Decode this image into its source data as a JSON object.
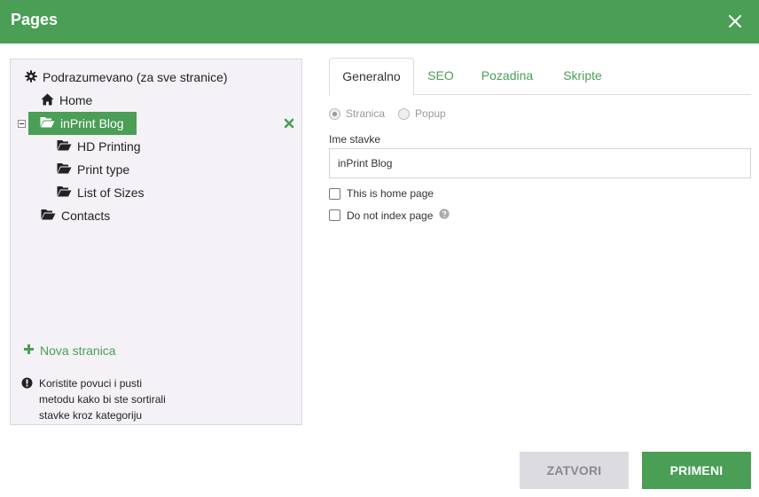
{
  "header": {
    "title": "Pages"
  },
  "tree": {
    "items": [
      {
        "label": "Podrazumevano (za sve stranice)",
        "icon": "gear-icon"
      },
      {
        "label": "Home",
        "icon": "home-icon"
      },
      {
        "label": "inPrint Blog",
        "icon": "folder-open-icon",
        "selected": true
      },
      {
        "label": "HD Printing",
        "icon": "folder-open-icon"
      },
      {
        "label": "Print type",
        "icon": "folder-open-icon"
      },
      {
        "label": "List of Sizes",
        "icon": "folder-open-icon"
      },
      {
        "label": "Contacts",
        "icon": "folder-open-icon"
      }
    ],
    "new_page_label": "Nova stranica",
    "hint": "Koristite povuci i pusti\nmetodu kako bi ste sortirali\nstavke kroz kategoriju"
  },
  "tabs": [
    {
      "label": "Generalno",
      "active": true
    },
    {
      "label": "SEO"
    },
    {
      "label": "Pozadina"
    },
    {
      "label": "Skripte"
    }
  ],
  "form": {
    "type_options": [
      {
        "label": "Stranica",
        "checked": true
      },
      {
        "label": "Popup",
        "checked": false
      }
    ],
    "name_label": "Ime stavke",
    "name_value": "inPrint Blog",
    "home_page_label": "This is home page",
    "home_page_checked": false,
    "no_index_label": "Do not index page",
    "no_index_checked": false
  },
  "buttons": {
    "close": "ZATVORI",
    "apply": "PRIMENI"
  },
  "colors": {
    "accent": "#4a9e56",
    "panel_bg": "#f4f2f6",
    "close_button_bg": "#dcdce0"
  }
}
